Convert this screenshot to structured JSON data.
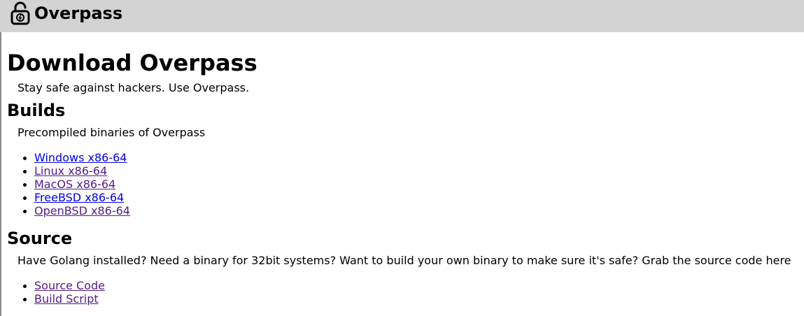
{
  "nav": {
    "title": "Overpass",
    "logo_icon": "padlock-icon"
  },
  "page": {
    "title": "Download Overpass",
    "tagline": "Stay safe against hackers. Use Overpass."
  },
  "builds": {
    "heading": "Builds",
    "description": "Precompiled binaries of Overpass",
    "links": [
      {
        "label": "Windows x86-64",
        "color": "#0000ee"
      },
      {
        "label": "Linux x86-64",
        "color": "#551a8b"
      },
      {
        "label": "MacOS x86-64",
        "color": "#551a8b"
      },
      {
        "label": "FreeBSD x86-64",
        "color": "#0000ee"
      },
      {
        "label": "OpenBSD x86-64",
        "color": "#551a8b"
      }
    ]
  },
  "source": {
    "heading": "Source",
    "description": "Have Golang installed? Need a binary for 32bit systems? Want to build your own binary to make sure it's safe? Grab the source code here",
    "links": [
      {
        "label": "Source Code",
        "color": "#551a8b"
      },
      {
        "label": "Build Script",
        "color": "#551a8b"
      }
    ]
  }
}
